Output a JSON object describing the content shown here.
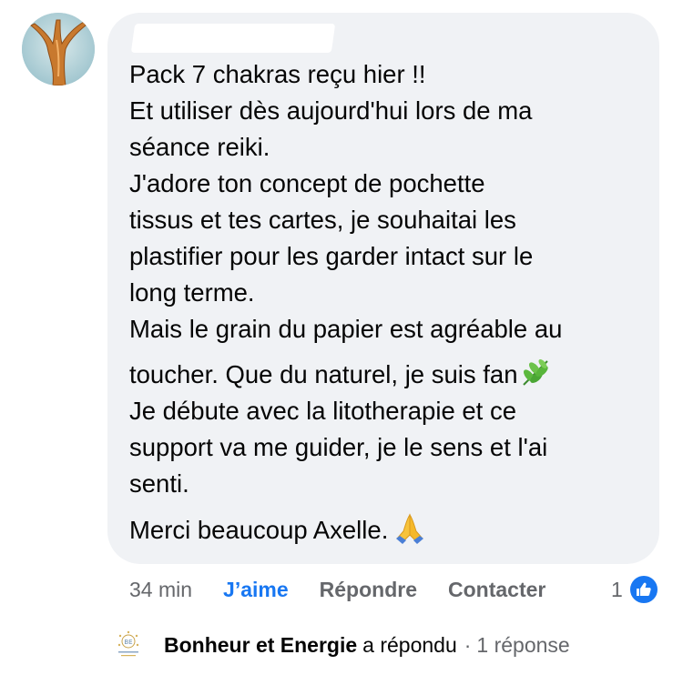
{
  "comment": {
    "lines": [
      "Pack 7 chakras reçu hier !!",
      "Et utiliser dès aujourd'hui lors de ma",
      "séance reiki.",
      "J'adore ton concept de pochette",
      "tissus et tes cartes, je souhaitai les",
      "plastifier pour les garder intact sur le",
      "long terme.",
      "Mais le grain du papier est agréable au",
      "toucher. Que du naturel, je suis fan",
      "Je débute avec la litotherapie et ce",
      "support va me guider, je le sens  et l'ai",
      "senti.",
      "Merci beaucoup Axelle."
    ],
    "leaf_emoji_icon": "herb-emoji",
    "pray_emoji_icon": "folded-hands-emoji"
  },
  "actions": {
    "time": "34 min",
    "like_label": "J’aime",
    "reply_label": "Répondre",
    "contact_label": "Contacter",
    "reaction_count": "1"
  },
  "reply_summary": {
    "page_name": "Bonheur et Energie",
    "replied_text": "a répondu",
    "separator": "·",
    "reply_count": "1 réponse"
  },
  "colors": {
    "accent": "#1877f2",
    "bubble": "#f0f2f5",
    "secondary_text": "#65676b"
  }
}
